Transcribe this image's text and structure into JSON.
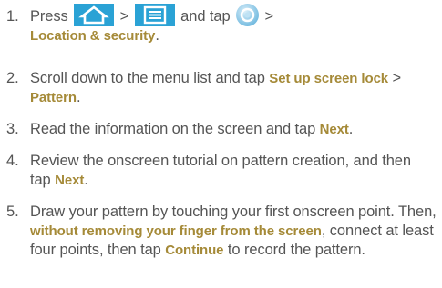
{
  "steps": [
    {
      "num": "1.",
      "line1_pre": "Press ",
      "gt1": " > ",
      "mid": " and tap ",
      "gt2": " >",
      "bold1": "Location & security",
      "end": "."
    },
    {
      "num": "2.",
      "pre": "Scroll down to the menu list and tap ",
      "bold1": "Set up screen lock",
      "gt": " > ",
      "bold2": "Pattern",
      "end": "."
    },
    {
      "num": "3.",
      "pre": "Read the information on the screen and tap ",
      "bold1": "Next",
      "end": "."
    },
    {
      "num": "4.",
      "pre": "Review the onscreen tutorial on pattern creation, and then tap ",
      "bold1": "Next",
      "end": "."
    },
    {
      "num": "5.",
      "pre": "Draw your pattern by touching your first onscreen point. Then, ",
      "bold1": "without removing your finger from the screen",
      "mid": ", connect at least four points, then tap ",
      "bold2": "Continue",
      "end": " to record the pattern."
    }
  ],
  "icons": {
    "home": "home-icon",
    "menu": "menu-icon",
    "settings": "settings-icon",
    "accent": "#2aa2d5",
    "bold_text_color": "#a58a38",
    "body_text_color": "#555555"
  }
}
